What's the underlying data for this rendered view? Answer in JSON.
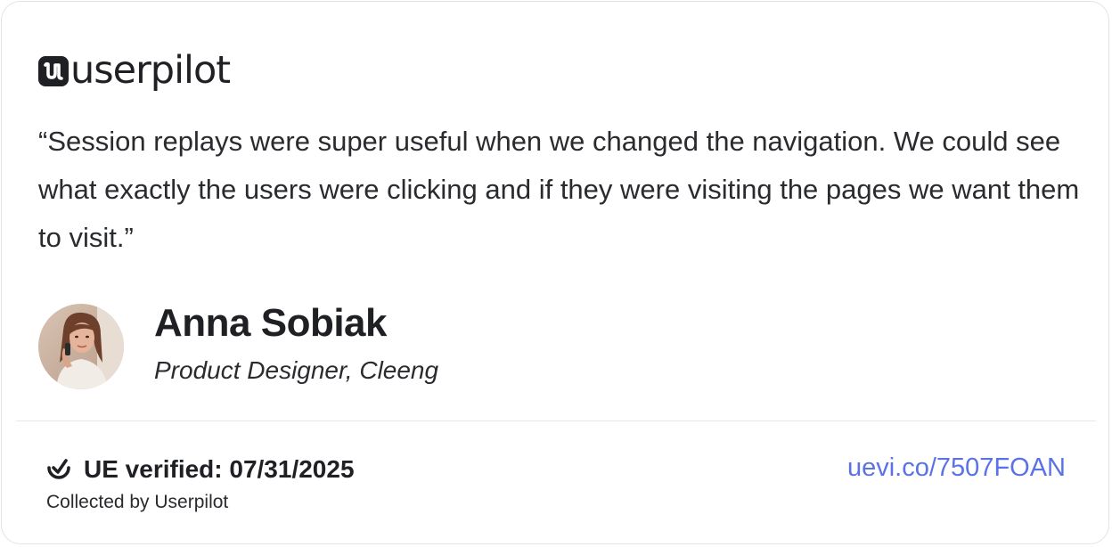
{
  "brand": {
    "name": "userpilot",
    "mark_letter": "u",
    "mark_icon": "userpilot-logo-mark-icon"
  },
  "testimonial": {
    "quote": "“Session replays were super useful when we changed the navigation. We could see what exactly the users were clicking and if they were visiting the pages we want them to visit.”"
  },
  "author": {
    "name": "Anna Sobiak",
    "title": "Product Designer, Cleeng",
    "avatar_icon": "avatar-photo"
  },
  "footer": {
    "verified_icon": "verified-check-icon",
    "verified_label": "UE verified: 07/31/2025",
    "collected_by": "Collected by Userpilot",
    "link_text": "uevi.co/7507FOAN"
  },
  "colors": {
    "link": "#5b72e6",
    "text": "#1f2023",
    "border": "#e3e3e6"
  }
}
